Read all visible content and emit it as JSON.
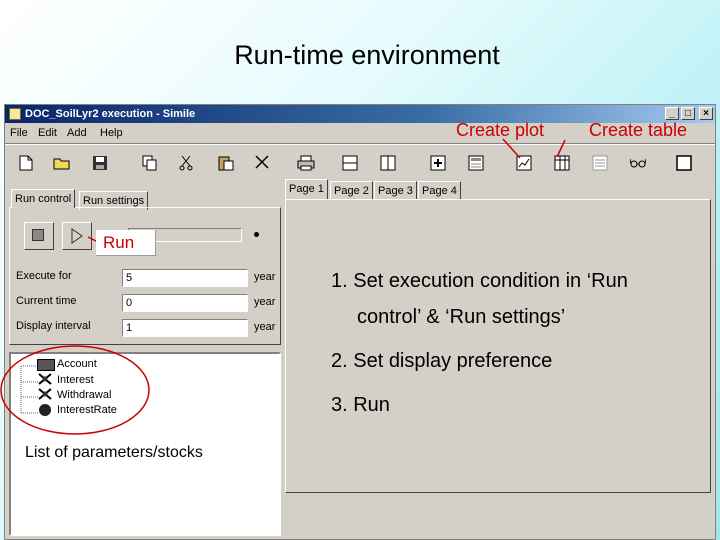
{
  "slide": {
    "title": "Run-time environment",
    "colors": {
      "annotation": "#cc0000",
      "titlebar": "#0a246a"
    }
  },
  "window": {
    "title": "DOC_SoilLyr2 execution - Simile",
    "buttons": {
      "minimize": "_",
      "maximize": "□",
      "close": "×"
    }
  },
  "menu": {
    "items": [
      "File",
      "Edit",
      "Add",
      "Help"
    ]
  },
  "toolbar": {
    "icons": [
      "new-file-icon",
      "open-folder-icon",
      "save-icon",
      "copy-icon",
      "cut-icon",
      "paste-icon",
      "delete-icon",
      "print-icon",
      "split-horizontal-icon",
      "split-vertical-icon",
      "add-helper-icon",
      "helper-icon",
      "plot-icon",
      "table-icon",
      "list-icon",
      "glasses-icon",
      "blank-window-icon"
    ]
  },
  "left_tabs": [
    "Run control",
    "Run settings"
  ],
  "run_control": {
    "fields": [
      {
        "label": "Execute for",
        "value": "5",
        "unit": "year"
      },
      {
        "label": "Current time",
        "value": "0",
        "unit": "year"
      },
      {
        "label": "Display interval",
        "value": "1",
        "unit": "year"
      }
    ]
  },
  "tree": {
    "items": [
      {
        "label": "Account",
        "icon": "stock-icon"
      },
      {
        "label": "Interest",
        "icon": "flow-icon"
      },
      {
        "label": "Withdrawal",
        "icon": "flow-icon"
      },
      {
        "label": "InterestRate",
        "icon": "variable-icon"
      }
    ]
  },
  "page_tabs": [
    "Page 1",
    "Page 2",
    "Page 3",
    "Page 4"
  ],
  "annotations": {
    "create_plot": "Create plot",
    "create_table": "Create table",
    "run": "Run",
    "list": "List of parameters/stocks"
  },
  "steps": [
    "1. Set execution condition in ‘Run",
    "control’ & ‘Run settings’",
    "2. Set display preference",
    "3. Run"
  ]
}
